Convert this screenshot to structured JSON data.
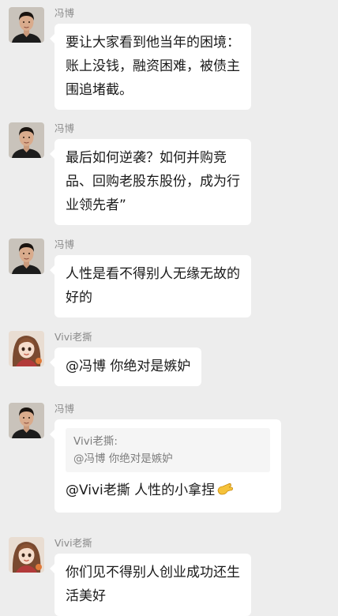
{
  "senders": {
    "fengbo": "冯博",
    "vivi": "Vivi老撕"
  },
  "icons": {
    "male_avatar": "avatar-man-black-shirt-icon",
    "female_avatar": "avatar-woman-cartoon-icon",
    "pinch_hand": "pinching-hand-emoji-icon"
  },
  "colors": {
    "background": "#ededed",
    "bubble": "#ffffff",
    "sender_name": "#8a8a8a",
    "quote_bg": "#f5f5f5"
  },
  "messages": [
    {
      "sender": "冯博",
      "lines": [
        "要让大家看到他当年的困境：",
        "账上没钱，融资困难，被债主",
        "围追堵截。"
      ]
    },
    {
      "sender": "冯博",
      "lines": [
        "最后如何逆袭？如何并购竞",
        "品、回购老股东股份，成为行",
        "业领先者”"
      ]
    },
    {
      "sender": "冯博",
      "lines": [
        "人性是看不得别人无缘无故的",
        "好的"
      ]
    },
    {
      "sender": "Vivi老撕",
      "lines": [
        "@冯博  你绝对是嫉妒"
      ]
    },
    {
      "sender": "冯博",
      "quote": {
        "author": "Vivi老撕:",
        "text": "@冯博  你绝对是嫉妒"
      },
      "lines": [
        "@Vivi老撕  人性的小拿捏"
      ]
    },
    {
      "sender": "Vivi老撕",
      "lines": [
        "你们见不得别人创业成功还生",
        "活美好"
      ]
    }
  ]
}
